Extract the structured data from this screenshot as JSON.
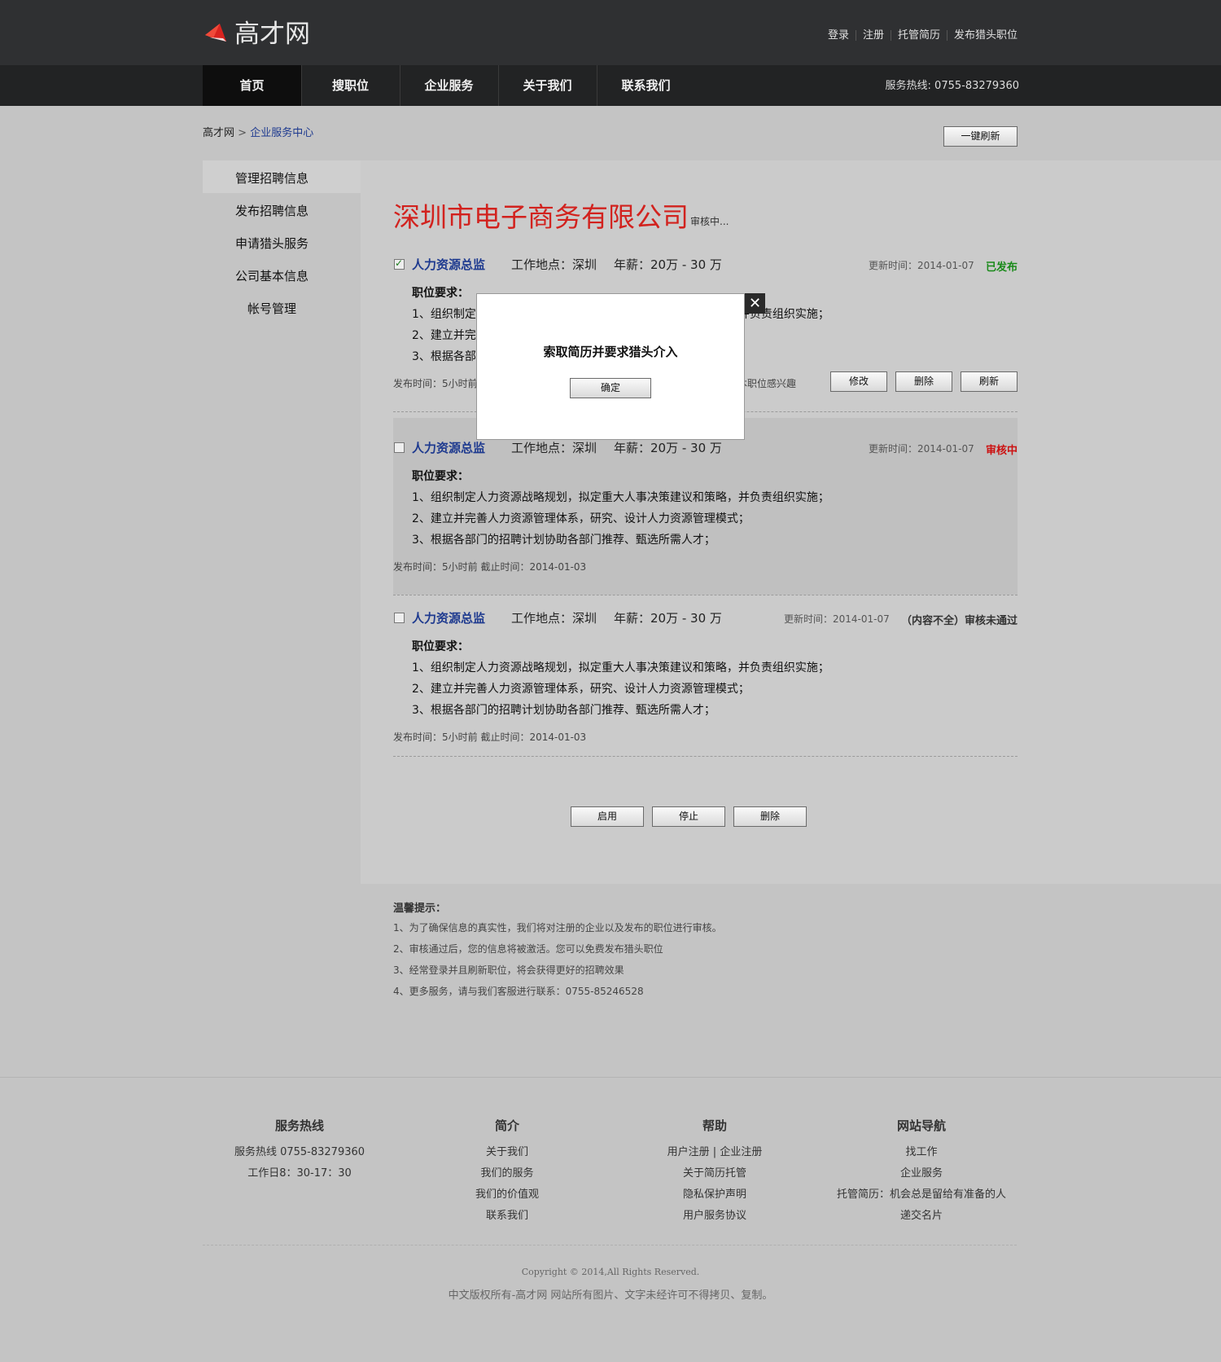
{
  "header": {
    "logo_text": "高才网",
    "top_links": [
      "登录",
      "注册",
      "托管简历",
      "发布猎头职位"
    ],
    "nav": [
      "首页",
      "搜职位",
      "企业服务",
      "关于我们",
      "联系我们"
    ],
    "hotline": "服务热线: 0755-83279360"
  },
  "breadcrumb": {
    "home": "高才网",
    "sep": ">",
    "current": "企业服务中心"
  },
  "refresh_all": "一键刷新",
  "sidebar": [
    "管理招聘信息",
    "发布招聘信息",
    "申请猎头服务",
    "公司基本信息",
    "帐号管理"
  ],
  "company": {
    "name": "深圳市电子商务有限公司",
    "status": "审核中..."
  },
  "jobs": [
    {
      "title": "人力资源总监",
      "location": "工作地点：深圳",
      "salary": "年薪：20万 - 30 万",
      "updated": "更新时间：2014-01-07",
      "status": "已发布",
      "status_color": "#1a8a1a",
      "req_title": "职位要求：",
      "reqs": [
        "1、组织制定人力资源战略规划，拟定重大人事决策建议和策略，并负责组织实施；",
        "2、建立并完善人力资源管理体系，研究、设计人力资源管理模式；",
        "3、根据各部门的招聘计划协助各部门推荐、甄选所需人才；"
      ],
      "meta": "发布时间：5小时前",
      "interest": "本职位感兴趣",
      "buttons": [
        "修改",
        "删除",
        "刷新"
      ]
    },
    {
      "title": "人力资源总监",
      "location": "工作地点：深圳",
      "salary": "年薪：20万 - 30 万",
      "updated": "更新时间：2014-01-07",
      "status": "审核中",
      "status_color": "#cc1111",
      "req_title": "职位要求：",
      "reqs": [
        "1、组织制定人力资源战略规划，拟定重大人事决策建议和策略，并负责组织实施；",
        "2、建立并完善人力资源管理体系，研究、设计人力资源管理模式；",
        "3、根据各部门的招聘计划协助各部门推荐、甄选所需人才；"
      ],
      "meta": "发布时间：5小时前    截止时间：2014-01-03"
    },
    {
      "title": "人力资源总监",
      "location": "工作地点：深圳",
      "salary": "年薪：20万 - 30 万",
      "updated": "更新时间：2014-01-07",
      "status": "（内容不全）审核未通过",
      "status_color": "#333333",
      "req_title": "职位要求：",
      "reqs": [
        "1、组织制定人力资源战略规划，拟定重大人事决策建议和策略，并负责组织实施；",
        "2、建立并完善人力资源管理体系，研究、设计人力资源管理模式；",
        "3、根据各部门的招聘计划协助各部门推荐、甄选所需人才；"
      ],
      "meta": "发布时间：5小时前    截止时间：2014-01-03"
    }
  ],
  "bulk_actions": [
    "启用",
    "停止",
    "删除"
  ],
  "tips": {
    "title": "温馨提示：",
    "items": [
      "1、为了确保信息的真实性，我们将对注册的企业以及发布的职位进行审核。",
      "2、审核通过后，您的信息将被激活。您可以免费发布猎头职位",
      "3、经常登录并且刷新职位，将会获得更好的招聘效果",
      "4、更多服务，请与我们客服进行联系：0755-85246528"
    ]
  },
  "footer": {
    "columns": [
      {
        "title": "服务热线",
        "items": [
          "服务热线 0755-83279360",
          "工作日8：30-17：30"
        ]
      },
      {
        "title": "简介",
        "items": [
          "关于我们",
          "我们的服务",
          "我们的价值观",
          "联系我们"
        ]
      },
      {
        "title": "帮助",
        "items": [
          "用户注册 | 企业注册",
          "关于简历托管",
          "隐私保护声明",
          "用户服务协议"
        ]
      },
      {
        "title": "网站导航",
        "items": [
          "找工作",
          "企业服务",
          "托管简历：机会总是留给有准备的人",
          "递交名片"
        ]
      }
    ],
    "copyright": "Copyright © 2014,All Rights Reserved.",
    "copyright_cn": "中文版权所有-高才网 网站所有图片、文字未经许可不得拷贝、复制。"
  },
  "modal": {
    "title": "索取简历并要求猎头介入",
    "confirm": "确定",
    "close_icon": "close-icon"
  },
  "colors": {
    "brand_red": "#d2221e",
    "header_bg": "#2f3032",
    "nav_bg": "#222324",
    "link_blue": "#1e3a8f"
  }
}
